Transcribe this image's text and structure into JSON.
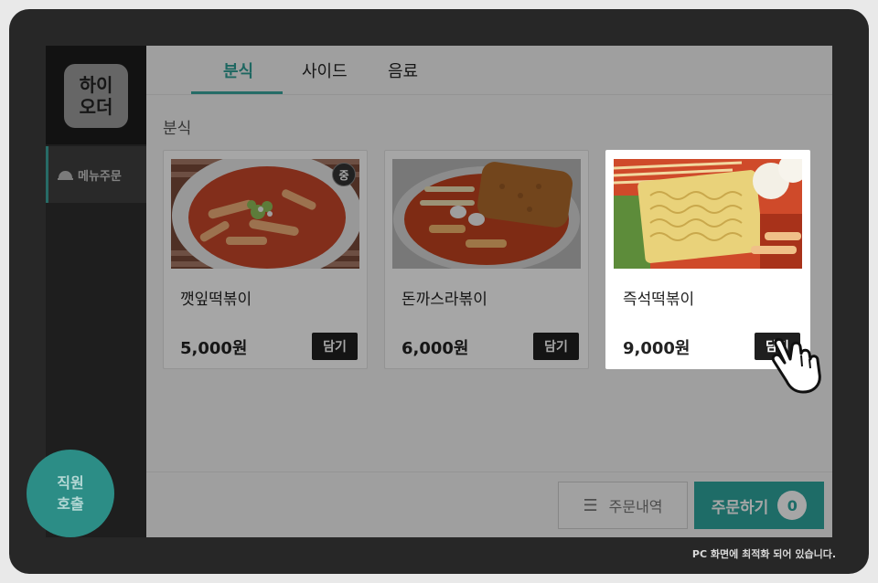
{
  "logo": {
    "line1": "하이",
    "line2": "오더"
  },
  "sidebar": {
    "menu_label": "메뉴주문"
  },
  "staff_call": {
    "line1": "직원",
    "line2": "호출"
  },
  "tabs": [
    {
      "label": "분식",
      "active": true
    },
    {
      "label": "사이드",
      "active": false
    },
    {
      "label": "음료",
      "active": false
    }
  ],
  "section_title": "분식",
  "items": [
    {
      "name": "깻잎떡볶이",
      "price": "5,000원",
      "add_label": "담기",
      "badge": "중"
    },
    {
      "name": "돈까스라볶이",
      "price": "6,000원",
      "add_label": "담기"
    },
    {
      "name": "즉석떡볶이",
      "price": "9,000원",
      "add_label": "담기",
      "highlighted": true
    }
  ],
  "footer": {
    "history_label": "주문내역",
    "order_label": "주문하기",
    "order_count": "0"
  },
  "footnote": "PC 화면에 최적화 되어 있습니다.",
  "colors": {
    "accent": "#2fa79f",
    "device": "#272727"
  }
}
